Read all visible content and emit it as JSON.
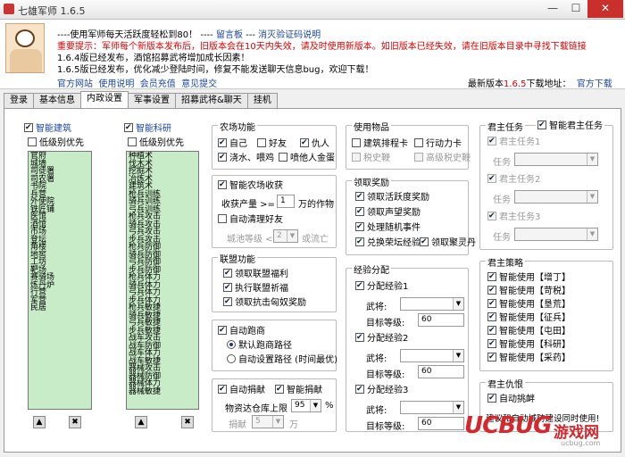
{
  "window": {
    "title": "七雄军师 1.6.5",
    "minimize": "—",
    "maximize": "☐",
    "close": "✕"
  },
  "header": {
    "line1a": "----使用军师每天活跃度轻松到80！ ----",
    "line1b": "留言板",
    "line1c": "---",
    "line1d": "消灭验证码说明",
    "notice": "重要提示：军师每个新版本发布后，旧版本会在10天内失效，请及时使用新版本。如旧版本已经失效，请在旧版本目录中寻找下载链接",
    "news1": "1.6.4版已经发布，酒馆招募武将增加成长因素！",
    "news2": "1.6.5版已经发布，优化减少登陆时间，修复不能发送聊天信息bug，欢迎下载！",
    "links": [
      "官方网站",
      "使用说明",
      "会员充值",
      "意见提交"
    ],
    "latest_prefix": "最新版本",
    "latest_version": "1.6.5",
    "latest_suffix": "下载地址：",
    "download": "官方下载"
  },
  "tabs": [
    "登录",
    "基本信息",
    "内政设置",
    "军事设置",
    "招募武将&聊天",
    "挂机"
  ],
  "active_tab": "内政设置",
  "build": {
    "title": "智能建筑",
    "low_first": "低级别优先",
    "items": [
      "官府",
      "城墙",
      "司徒署",
      "司农署",
      "书院",
      "兵营",
      "外使院",
      "铁匠铺",
      "医馆",
      "酒馆",
      "市场",
      "登坛",
      "角楼",
      "地窖",
      "工坊",
      "靶场",
      "赛骑场",
      "炼丹炉",
      "行营",
      "军营",
      "民居"
    ]
  },
  "research": {
    "title": "智能科研",
    "low_first": "低级别优先",
    "items": [
      "种植术",
      "伐木术",
      "挖掘术",
      "冶炼术",
      "建筑术",
      "枪兵训练",
      "骑兵训练",
      "弓兵训练",
      "枪兵攻击",
      "骑兵攻击",
      "弓兵攻击",
      "步兵攻击",
      "枪兵防御",
      "骑兵防御",
      "弓兵防御",
      "步兵防御",
      "枪兵体力",
      "骑兵体力",
      "弓兵体力",
      "步兵体力",
      "枪兵敏捷",
      "骑兵敏捷",
      "弓兵敏捷",
      "步兵敏捷",
      "战车攻击",
      "战车防御",
      "战车体力",
      "战车敏捷",
      "器械攻击",
      "器械防御",
      "器械体力",
      "器械敏捷"
    ]
  },
  "farm": {
    "title": "农场功能",
    "own": "自己",
    "friend": "好友",
    "enemy": "仇人",
    "water": "浇水、喂鸡",
    "spray": "喷他人金蛋",
    "smart": "智能农场收获",
    "yield_label": "收获产量 >=",
    "yield_value": "1",
    "yield_unit": "万的作物",
    "auto_clear": "自动清理好友",
    "city_level": "城池等级 <",
    "city_value": "2",
    "or_dead": "或流亡"
  },
  "alliance": {
    "title": "联盟功能",
    "collect": "领取联盟福利",
    "execute": "执行联盟祈福",
    "reward": "领取抗击匈奴奖励"
  },
  "run": {
    "title": "自动跑商",
    "default": "默认跑商路径",
    "custom": "自动设置路径 (时间最优)"
  },
  "donate": {
    "title": "自动捐献",
    "smart": "智能捐献",
    "cap_label": "物资达仓库上限",
    "cap_value": "95",
    "cap_unit": "%",
    "amount_label": "捐献",
    "amount_value": "5",
    "amount_unit": "万"
  },
  "items": {
    "title": "使用物品",
    "build_card": "建筑排程卡",
    "move_card": "行动力卡",
    "tax_whip": "税史鞭",
    "adv_whip": "高级税史鞭"
  },
  "rewards": {
    "title": "领取奖励",
    "active": "领取活跃度奖励",
    "prestige": "领取声望奖励",
    "random": "处理随机事件",
    "exchange": "兑换荣坛经验",
    "spirit": "领取聚灵丹"
  },
  "exp": {
    "title": "经验分配",
    "groups": [
      {
        "label": "分配经验1",
        "general": "武将:",
        "level": "目标等级:",
        "level_value": "60"
      },
      {
        "label": "分配经验2",
        "general": "武将:",
        "level": "目标等级:",
        "level_value": "60"
      },
      {
        "label": "分配经验3",
        "general": "武将:",
        "level": "目标等级:",
        "level_value": "60"
      }
    ]
  },
  "lord": {
    "title": "君主任务",
    "smart": "智能君主任务",
    "tasks": [
      "君主任务1",
      "君主任务2",
      "君主任务3"
    ],
    "task_label": "任务"
  },
  "strategy": {
    "title": "君主策略",
    "items": [
      "智能使用【增丁】",
      "智能使用【苛税】",
      "智能使用【垦荒】",
      "智能使用【征兵】",
      "智能使用【屯田】",
      "智能使用【科研】",
      "智能使用【采药】"
    ]
  },
  "revenge": {
    "title": "君主仇恨",
    "auto": "自动挑衅",
    "note": "建议和自动城防建设同时使用!"
  },
  "watermark": {
    "logo": "UCBUG",
    "cn": "游戏网",
    "url": "ucbug.com"
  }
}
